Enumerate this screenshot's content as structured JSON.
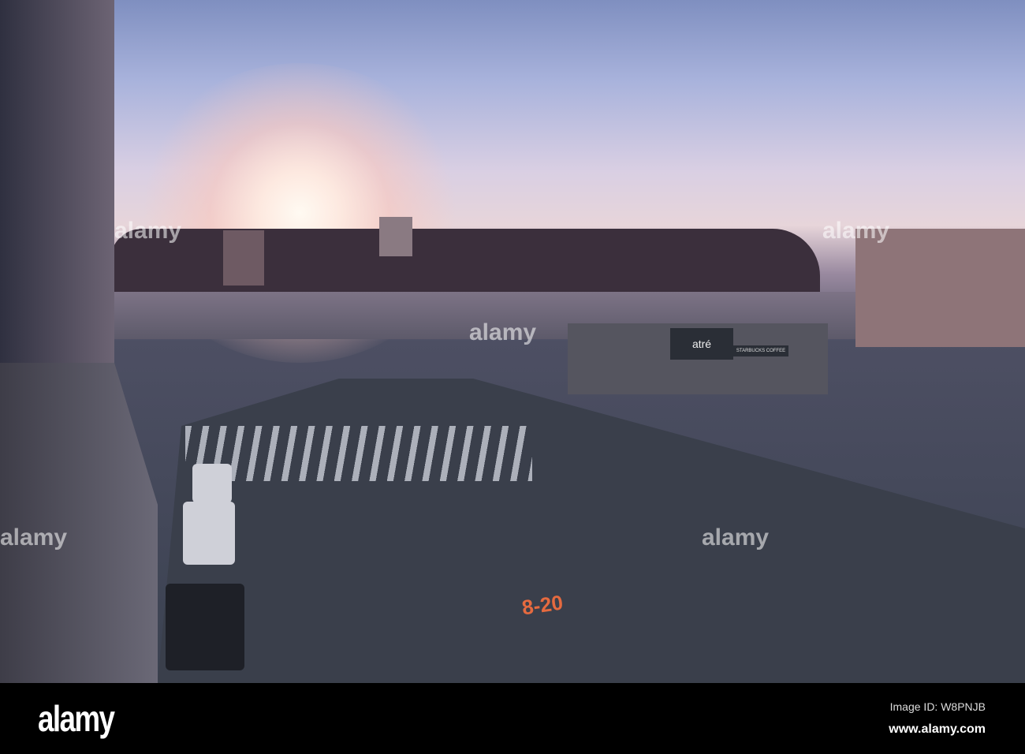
{
  "photo": {
    "signs": {
      "store": "atré",
      "cafe": "STARBUCKS COFFEE"
    },
    "road_marking": "8-20",
    "watermark": "alamy"
  },
  "footer": {
    "logo": "alamy",
    "image_id": "Image ID: W8PNJB",
    "url": "www.alamy.com"
  }
}
